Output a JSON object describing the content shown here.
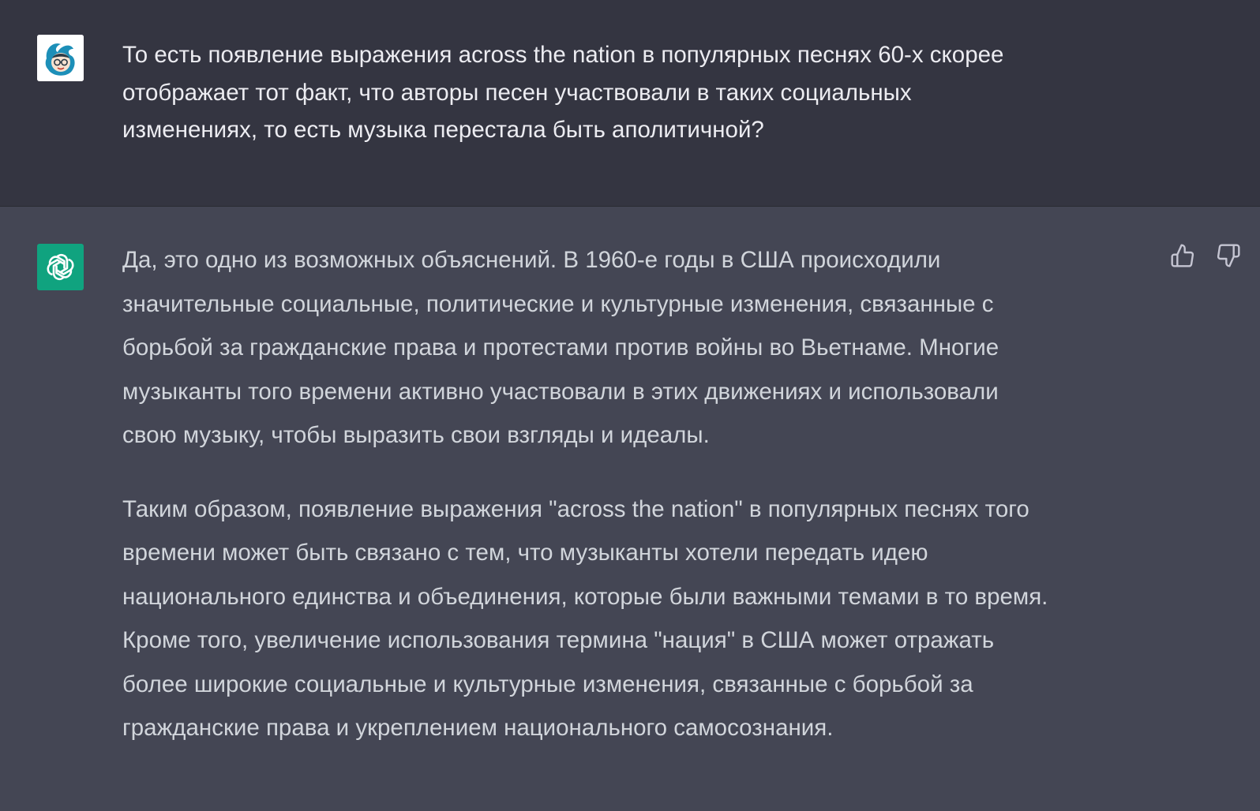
{
  "conversation": {
    "user_message": {
      "avatar_icon": "user-avatar-icon",
      "text": "То есть появление выражения across the nation в популярных песнях 60-х скорее\nотображает тот факт, что авторы песен участвовали в таких социальных\nизменениях, то есть музыка перестала быть аполитичной?"
    },
    "assistant_message": {
      "avatar_icon": "openai-logo-icon",
      "paragraphs": [
        "Да, это одно из возможных объяснений. В 1960-е годы в США происходили\nзначительные социальные, политические и культурные изменения, связанные с\nборьбой за гражданские права и протестами против войны во Вьетнаме. Многие\nмузыканты того времени активно участвовали в этих движениях и использовали\nсвою музыку, чтобы выразить свои взгляды и идеалы.",
        "Таким образом, появление выражения \"across the nation\" в популярных песнях того\nвремени может быть связано с тем, что музыканты хотели передать идею\nнационального единства и объединения, которые были важными темами в то время.\nКроме того, увеличение использования термина \"нация\" в США может отражать\nболее широкие социальные и культурные изменения, связанные с борьбой за\nгражданские права и укреплением национального самосознания."
      ],
      "feedback": {
        "like_icon": "thumbs-up-icon",
        "dislike_icon": "thumbs-down-icon"
      }
    }
  },
  "colors": {
    "user_bg": "#343541",
    "assistant_bg": "#444654",
    "brand_green": "#10a37f",
    "text": "#ececf1"
  }
}
